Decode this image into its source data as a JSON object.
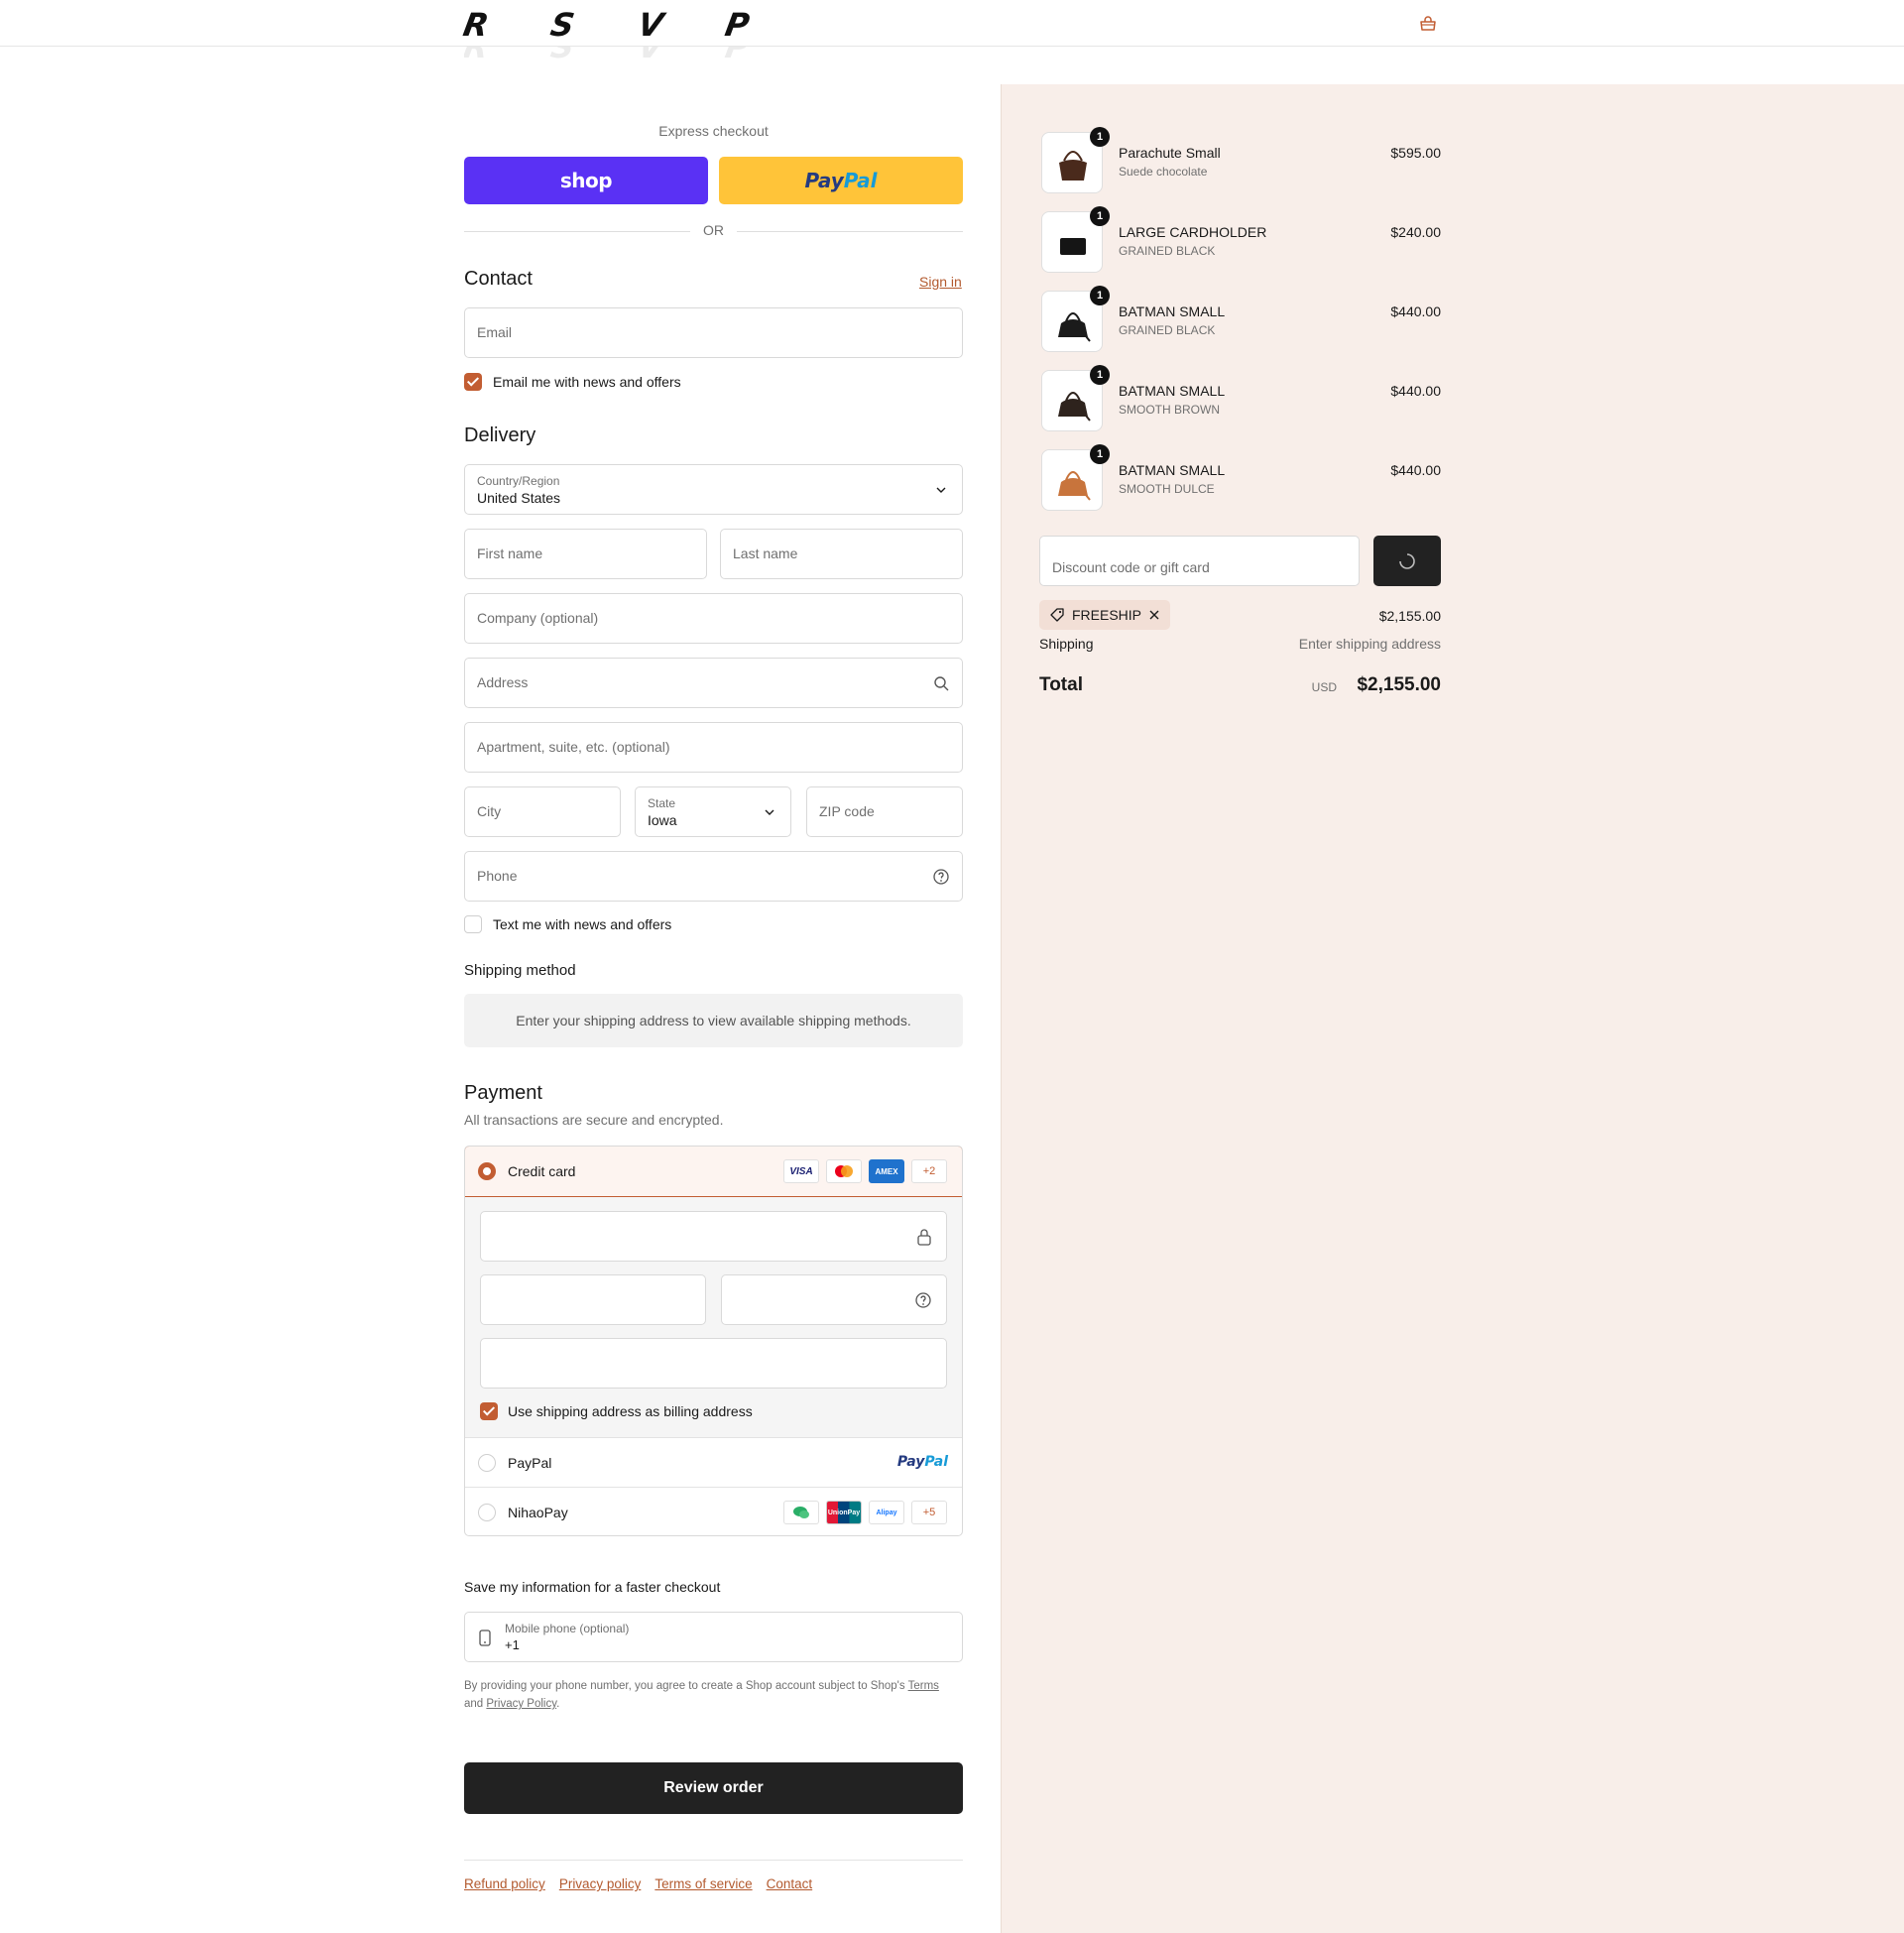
{
  "header": {
    "logo_letters": [
      "R",
      "S",
      "V",
      "P"
    ],
    "cart_icon": "shopping-bag-icon"
  },
  "express": {
    "title": "Express checkout",
    "shop_label": "shop",
    "paypal_label_1": "Pay",
    "paypal_label_2": "Pal",
    "or": "OR"
  },
  "contact": {
    "title": "Contact",
    "sign_in": "Sign in",
    "email_placeholder": "Email",
    "news_label": "Email me with news and offers",
    "news_checked": true
  },
  "delivery": {
    "title": "Delivery",
    "country_label": "Country/Region",
    "country_value": "United States",
    "first_name": "First name",
    "last_name": "Last name",
    "company": "Company (optional)",
    "address": "Address",
    "apartment": "Apartment, suite, etc. (optional)",
    "city": "City",
    "state_label": "State",
    "state_value": "Iowa",
    "zip": "ZIP code",
    "phone": "Phone",
    "text_label": "Text me with news and offers",
    "text_checked": false
  },
  "shipping_method": {
    "title": "Shipping method",
    "message": "Enter your shipping address to view available shipping methods."
  },
  "payment": {
    "title": "Payment",
    "subtitle": "All transactions are secure and encrypted.",
    "credit_card": "Credit card",
    "card_logos": [
      "VISA",
      "Mastercard",
      "AMEX"
    ],
    "more_cards": "+2",
    "billing_label": "Use shipping address as billing address",
    "billing_checked": true,
    "paypal": "PayPal",
    "paypal_logo_1": "Pay",
    "paypal_logo_2": "Pal",
    "nihaopay": "NihaoPay",
    "nihao_logos": [
      "WeChat Pay",
      "UnionPay",
      "Alipay"
    ],
    "more_nihao": "+5"
  },
  "save_info": {
    "title": "Save my information for a faster checkout",
    "mobile_label": "Mobile phone (optional)",
    "mobile_value": "+1",
    "fine_1": "By providing your phone number, you agree to create a Shop account subject to Shop's ",
    "terms": "Terms",
    "fine_2": "and ",
    "privacy": "Privacy Policy",
    "fine_3": "."
  },
  "review_button": "Review order",
  "footer": {
    "links": [
      "Refund policy",
      "Privacy policy",
      "Terms of service",
      "Contact"
    ]
  },
  "summary": {
    "items": [
      {
        "name": "Parachute Small",
        "variant": "Suede chocolate",
        "price": "$595.00",
        "qty": "1",
        "color": "#4a2a1c"
      },
      {
        "name": "LARGE CARDHOLDER",
        "variant": "GRAINED BLACK",
        "price": "$240.00",
        "qty": "1",
        "color": "#151515"
      },
      {
        "name": "BATMAN SMALL",
        "variant": "GRAINED BLACK",
        "price": "$440.00",
        "qty": "1",
        "color": "#1b1b1b"
      },
      {
        "name": "BATMAN SMALL",
        "variant": "SMOOTH BROWN",
        "price": "$440.00",
        "qty": "1",
        "color": "#2e231d"
      },
      {
        "name": "BATMAN SMALL",
        "variant": "SMOOTH DULCE",
        "price": "$440.00",
        "qty": "1",
        "color": "#c8743c"
      }
    ],
    "discount_placeholder": "Discount code or gift card",
    "discount_code": "FREESHIP",
    "subtotal": "$2,155.00",
    "shipping_label": "Shipping",
    "shipping_value": "Enter shipping address",
    "total_label": "Total",
    "currency": "USD",
    "total": "$2,155.00"
  },
  "colors": {
    "accent": "#c25d32",
    "shop_purple": "#5a31f4",
    "paypal_yellow": "#ffc439",
    "summary_bg": "#f8eee9"
  }
}
